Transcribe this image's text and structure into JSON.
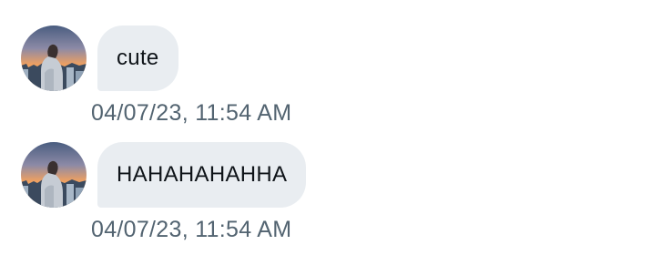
{
  "messages": [
    {
      "sender_avatar": "avatar-photo-person-sunset-city",
      "text": "cute",
      "timestamp": "04/07/23, 11:54 AM"
    },
    {
      "sender_avatar": "avatar-photo-person-sunset-city",
      "text": "HAHAHAHAHHA",
      "timestamp": "04/07/23, 11:54 AM"
    }
  ],
  "colors": {
    "bubble_background": "#e9edf1",
    "message_text": "#0f1419",
    "timestamp_text": "#536471",
    "page_background": "#ffffff"
  }
}
